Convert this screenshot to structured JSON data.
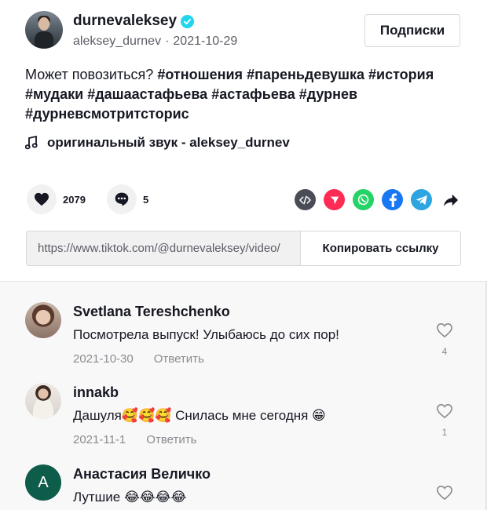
{
  "post": {
    "author_name": "durnevaleksey",
    "username": "aleksey_durnev",
    "separator": "·",
    "date": "2021-10-29",
    "follow_label": "Подписки",
    "caption_text": "Может повозиться?",
    "hashtags": [
      "#отношения",
      "#пареньдевушка",
      "#история",
      "#мудаки",
      "#дашаастафьева",
      "#астафьева",
      "#дурнев",
      "#дурневсмотритсторис"
    ],
    "music_label": "оригинальный звук - aleksey_durnev",
    "likes": "2079",
    "comments_count": "5",
    "share_icons": [
      "embed-icon",
      "send-icon",
      "whatsapp-icon",
      "facebook-icon",
      "telegram-icon",
      "share-arrow-icon"
    ],
    "link_url": "https://www.tiktok.com/@durnevaleksey/video/",
    "copy_label": "Копировать ссылку"
  },
  "comments": [
    {
      "name": "Svetlana Tereshchenko",
      "text": "Посмотрела выпуск! Улыбаюсь до сих пор!",
      "date": "2021-10-30",
      "reply": "Ответить",
      "likes": "4"
    },
    {
      "name": "innakb",
      "text": "Дашуля🥰🥰🥰 Снилась мне сегодня 😁",
      "date": "2021-11-1",
      "reply": "Ответить",
      "likes": "1"
    },
    {
      "name": "Анастасия Величко",
      "avatar_letter": "A",
      "text": "Лутшие 😂😂😂😂",
      "date": "",
      "reply": "",
      "likes": ""
    }
  ],
  "colors": {
    "verified": "#20d5ec",
    "embed": "#4a4d57",
    "send": "#fe2c55",
    "whatsapp": "#25d366",
    "facebook": "#1877f2",
    "telegram": "#2ca5e0",
    "avatar_letter_bg": "#0e5c4a"
  }
}
